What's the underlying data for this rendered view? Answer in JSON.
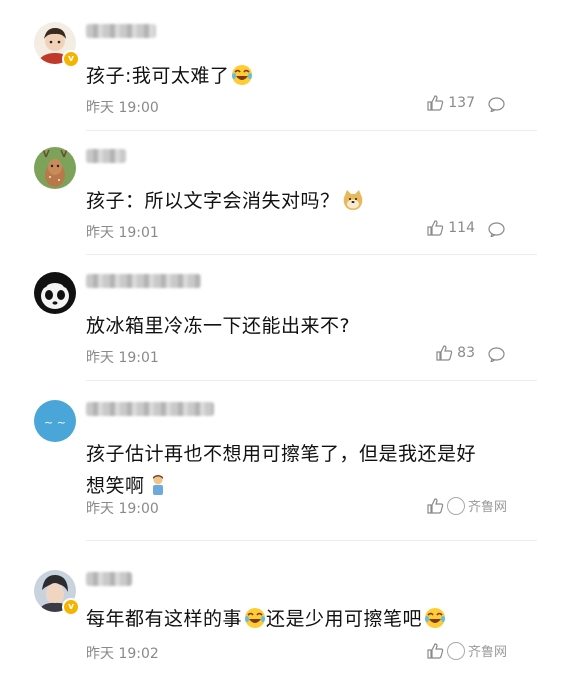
{
  "comments": [
    {
      "text": "孩子:我可太难了",
      "time": "昨天 19:00",
      "likes": "137",
      "emoji": "laugh-cry-emoji",
      "verified": true
    },
    {
      "text": "孩子：所以文字会消失对吗？",
      "time": "昨天 19:01",
      "likes": "114",
      "emoji": "doge-emoji",
      "verified": false
    },
    {
      "text": "放冰箱里冷冻一下还能出来不?",
      "time": "昨天 19:01",
      "likes": "83",
      "verified": false
    },
    {
      "text_line1": "孩子估计再也不想用可擦笔了，但是我还是好",
      "text_line2": "想笑啊",
      "time": "昨天 19:00",
      "emoji": "person-emoji",
      "verified": false
    },
    {
      "text": "每年都有这样的事",
      "text_after": "还是少用可擦笔吧",
      "time": "昨天 19:02",
      "emoji": "laugh-cry-emoji",
      "verified": true
    }
  ],
  "watermark": "齐鲁网",
  "colors": {
    "text": "#111111",
    "muted": "#8a8a8a",
    "badge": "#f5b400",
    "divider": "#ececec"
  }
}
